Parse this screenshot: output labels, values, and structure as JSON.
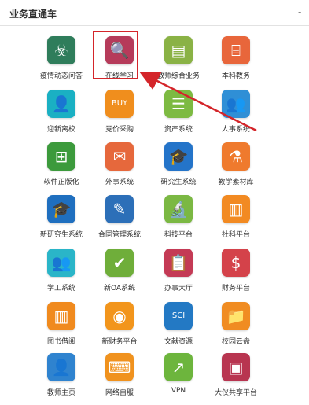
{
  "header": {
    "title": "业务直通车",
    "collapse_symbol": "-"
  },
  "apps": [
    {
      "label": "疫情动态问答",
      "icon": "biohazard-icon",
      "glyph": "☣",
      "color": "#2f7d5b"
    },
    {
      "label": "在线学习",
      "icon": "online-learning-icon",
      "glyph": "🔍",
      "color": "#b63b5a",
      "highlighted": true
    },
    {
      "label": "教师综合业务",
      "icon": "teacher-business-icon",
      "glyph": "▤",
      "color": "#8ab245"
    },
    {
      "label": "本科教务",
      "icon": "undergrad-affairs-icon",
      "glyph": "⌸",
      "color": "#e8663b"
    },
    {
      "label": "迎新离校",
      "icon": "welcome-leave-icon",
      "glyph": "👤",
      "color": "#1ab0c3"
    },
    {
      "label": "竞价采购",
      "icon": "buy-icon",
      "glyph": "BUY",
      "color": "#f08e1d"
    },
    {
      "label": "资产系统",
      "icon": "database-icon",
      "glyph": "☰",
      "color": "#7dba42"
    },
    {
      "label": "人事系统",
      "icon": "personnel-icon",
      "glyph": "👥",
      "color": "#2f8fd6"
    },
    {
      "label": "软件正版化",
      "icon": "windows-icon",
      "glyph": "⊞",
      "color": "#3c9a3c"
    },
    {
      "label": "外事系统",
      "icon": "foreign-affairs-icon",
      "glyph": "✉",
      "color": "#e6683c"
    },
    {
      "label": "研究生系统",
      "icon": "graduate-icon",
      "glyph": "🎓",
      "color": "#2474c9"
    },
    {
      "label": "教学素材库",
      "icon": "teaching-material-icon",
      "glyph": "⚗",
      "color": "#ef7a2d"
    },
    {
      "label": "新研究生系统",
      "icon": "new-graduate-icon",
      "glyph": "🎓",
      "color": "#1f6fbf"
    },
    {
      "label": "合同管理系统",
      "icon": "contract-icon",
      "glyph": "✎",
      "color": "#2c6fb8"
    },
    {
      "label": "科技平台",
      "icon": "microscope-icon",
      "glyph": "🔬",
      "color": "#7bb843"
    },
    {
      "label": "社科平台",
      "icon": "social-science-icon",
      "glyph": "▥",
      "color": "#f28a22"
    },
    {
      "label": "学工系统",
      "icon": "student-work-icon",
      "glyph": "👥",
      "color": "#2ab5c8"
    },
    {
      "label": "新OA系统",
      "icon": "oa-icon",
      "glyph": "✔",
      "color": "#6fae3a"
    },
    {
      "label": "办事大厅",
      "icon": "service-hall-icon",
      "glyph": "📋",
      "color": "#c43a55"
    },
    {
      "label": "财务平台",
      "icon": "finance-icon",
      "glyph": "$",
      "color": "#d4424a"
    },
    {
      "label": "图书借阅",
      "icon": "books-icon",
      "glyph": "▥",
      "color": "#f08a1e"
    },
    {
      "label": "新财务平台",
      "icon": "coins-icon",
      "glyph": "◉",
      "color": "#f2951c"
    },
    {
      "label": "文献资源",
      "icon": "literature-icon",
      "glyph": "SCI",
      "color": "#2379c4"
    },
    {
      "label": "校园云盘",
      "icon": "folder-icon",
      "glyph": "📁",
      "color": "#f08c22"
    },
    {
      "label": "教师主页",
      "icon": "teacher-home-icon",
      "glyph": "👤",
      "color": "#2f83cf"
    },
    {
      "label": "网络自服",
      "icon": "network-self-service-icon",
      "glyph": "⌨",
      "color": "#f0921e"
    },
    {
      "label": "VPN",
      "icon": "vpn-icon",
      "glyph": "↗",
      "color": "#6db53d"
    },
    {
      "label": "大仪共享平台",
      "icon": "instrument-share-icon",
      "glyph": "▣",
      "color": "#b83550"
    }
  ],
  "accent_color": "#d4252a"
}
